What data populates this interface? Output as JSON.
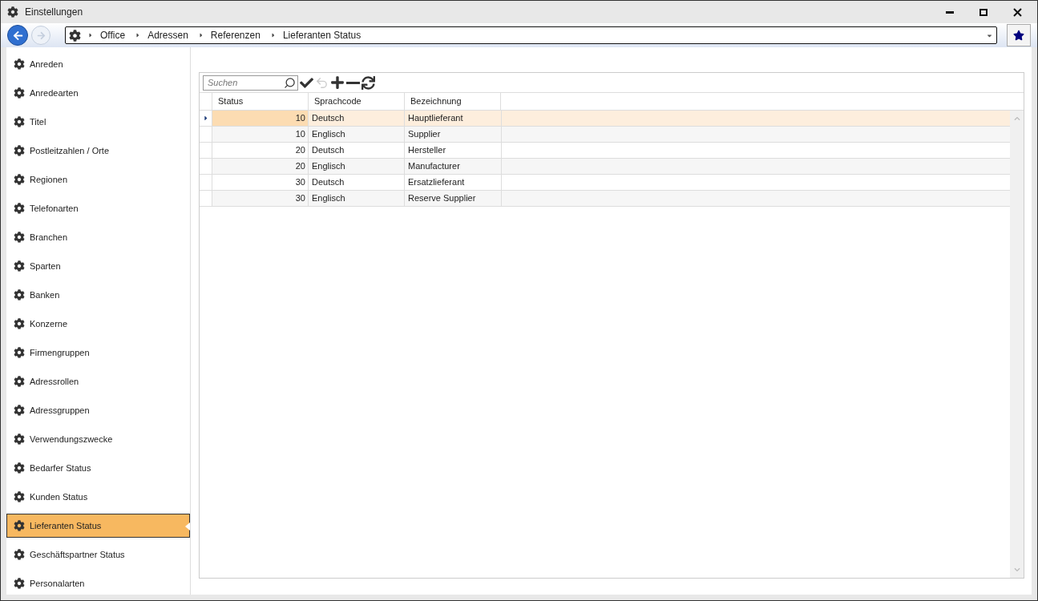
{
  "window": {
    "title": "Einstellungen"
  },
  "breadcrumb": [
    "Office",
    "Adressen",
    "Referenzen",
    "Lieferanten Status"
  ],
  "sidebar": {
    "items": [
      {
        "label": "Anreden",
        "selected": false
      },
      {
        "label": "Anredearten",
        "selected": false
      },
      {
        "label": "Titel",
        "selected": false
      },
      {
        "label": "Postleitzahlen / Orte",
        "selected": false
      },
      {
        "label": "Regionen",
        "selected": false
      },
      {
        "label": "Telefonarten",
        "selected": false
      },
      {
        "label": "Branchen",
        "selected": false
      },
      {
        "label": "Sparten",
        "selected": false
      },
      {
        "label": "Banken",
        "selected": false
      },
      {
        "label": "Konzerne",
        "selected": false
      },
      {
        "label": "Firmengruppen",
        "selected": false
      },
      {
        "label": "Adressrollen",
        "selected": false
      },
      {
        "label": "Adressgruppen",
        "selected": false
      },
      {
        "label": "Verwendungszwecke",
        "selected": false
      },
      {
        "label": "Bedarfer Status",
        "selected": false
      },
      {
        "label": "Kunden Status",
        "selected": false
      },
      {
        "label": "Lieferanten Status",
        "selected": true
      },
      {
        "label": "Geschäftspartner Status",
        "selected": false
      },
      {
        "label": "Personalarten",
        "selected": false
      }
    ]
  },
  "grid": {
    "search": {
      "placeholder": "Suchen"
    },
    "undo_disabled": true,
    "columns": [
      "Status",
      "Sprachcode",
      "Bezeichnung"
    ],
    "rows": [
      {
        "status": "10",
        "language": "Deutsch",
        "name": "Hauptlieferant",
        "selected": true
      },
      {
        "status": "10",
        "language": "Englisch",
        "name": "Supplier",
        "selected": false
      },
      {
        "status": "20",
        "language": "Deutsch",
        "name": "Hersteller",
        "selected": false
      },
      {
        "status": "20",
        "language": "Englisch",
        "name": "Manufacturer",
        "selected": false
      },
      {
        "status": "30",
        "language": "Deutsch",
        "name": "Ersatzlieferant",
        "selected": false
      },
      {
        "status": "30",
        "language": "Englisch",
        "name": "Reserve Supplier",
        "selected": false
      }
    ]
  }
}
